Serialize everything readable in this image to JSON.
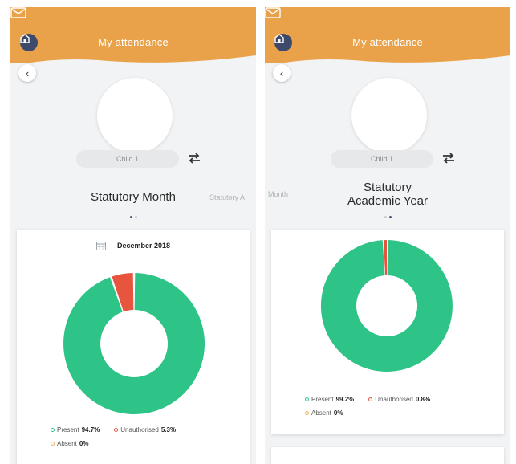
{
  "colors": {
    "header_orange": "#e9a24a",
    "present": "#2fc487",
    "unauthorised": "#e8553f",
    "absent": "#f4b05c",
    "home_button": "#3d4a6b"
  },
  "screens": [
    {
      "header": {
        "title": "My attendance",
        "home_icon": "home-icon",
        "mail_icon": "mail-icon"
      },
      "child_name": "Child 1",
      "view_title": "Statutory Month",
      "peek_next": "Statutory A",
      "card": {
        "month": "December 2018"
      },
      "chart_data": {
        "type": "pie",
        "categories": [
          "Present",
          "Unauthorised",
          "Absent"
        ],
        "values": [
          94.7,
          5.3,
          0
        ]
      },
      "legend": [
        {
          "label": "Present",
          "value": "94.7%"
        },
        {
          "label": "Unauthorised",
          "value": "5.3%"
        },
        {
          "label": "Absent",
          "value": "0%"
        }
      ]
    },
    {
      "header": {
        "title": "My attendance",
        "home_icon": "home-icon",
        "mail_icon": "mail-icon"
      },
      "child_name": "Child 1",
      "view_title_line1": "Statutory",
      "view_title_line2": "Academic Year",
      "peek_prev": "Month",
      "chart_data": {
        "type": "pie",
        "categories": [
          "Present",
          "Unauthorised",
          "Absent"
        ],
        "values": [
          99.2,
          0.8,
          0
        ]
      },
      "legend": [
        {
          "label": "Present",
          "value": "99.2%"
        },
        {
          "label": "Unauthorised",
          "value": "0.8%"
        },
        {
          "label": "Absent",
          "value": "0%"
        }
      ]
    }
  ]
}
